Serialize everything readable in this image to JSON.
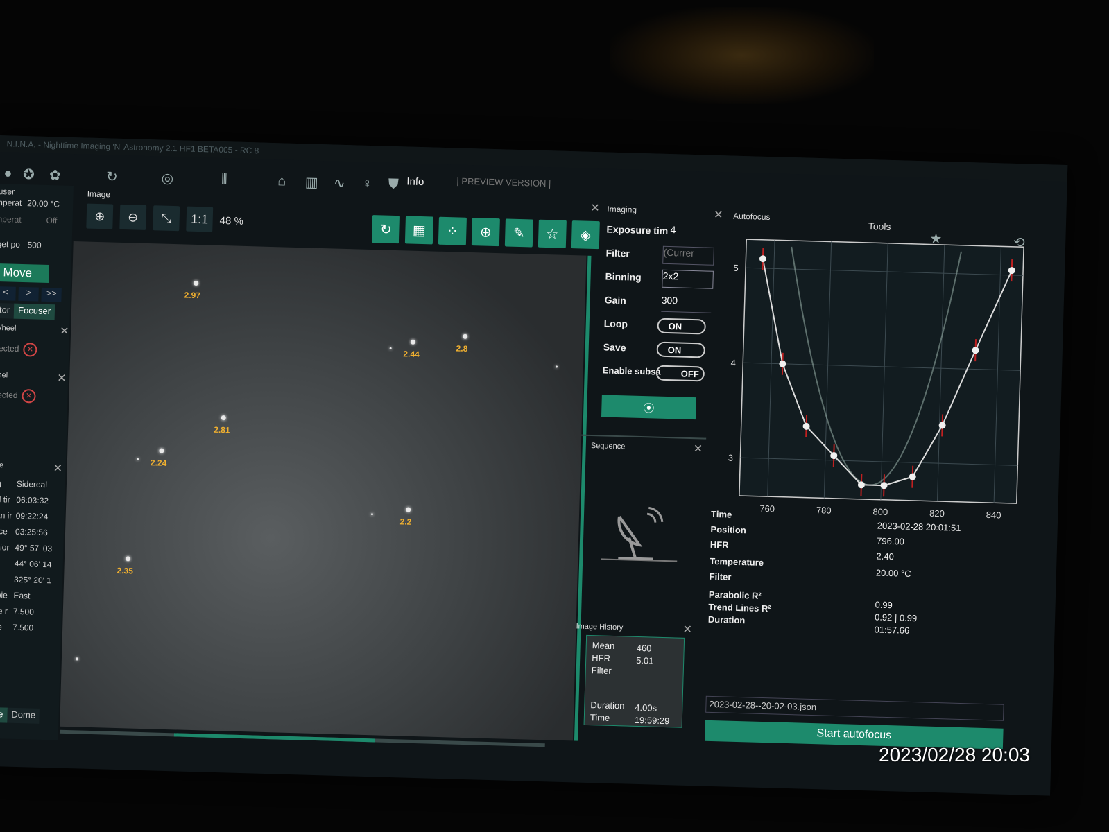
{
  "window": {
    "title": "N.I.N.A. - Nighttime Imaging 'N' Astronomy 2.1 HF1 BETA005 - RC 8",
    "preview_label": "| PREVIEW VERSION |"
  },
  "toolbar": {
    "info_label": "Info"
  },
  "left": {
    "focuser_header": "user",
    "temp_label": "nperat",
    "temp_value": "20.00 °C",
    "temp2_label": "nperat",
    "temp2_value": "Off",
    "target_label": "get po",
    "target_value": "500",
    "move_label": "Move",
    "nav": [
      "<",
      ">",
      ">>"
    ],
    "tabs": [
      "tor",
      "Focuser"
    ],
    "filterwheel_header": "Wheel",
    "filterwheel_status": "nected",
    "panel_header": "anel",
    "panel_status": "nected",
    "mount_header": "ope",
    "mount_rows": [
      {
        "k": "ing",
        "v": "Sidereal"
      },
      {
        "k": "eal tir",
        "v": "06:03:32"
      },
      {
        "k": "dian ir",
        "v": "09:22:24"
      },
      {
        "k": "Asce",
        "v": "03:25:56"
      },
      {
        "k": "natior",
        "v": "49° 57' 03"
      },
      {
        "k": "de",
        "v": "44° 06' 14"
      },
      {
        "k": "uth",
        "v": "325° 20' 1"
      },
      {
        "k": "of pie",
        "v": "East"
      },
      {
        "k": "uide r",
        "v": "7.500"
      },
      {
        "k": "uide",
        "v": "7.500"
      }
    ],
    "bottom_tabs": [
      "ope",
      "Dome"
    ]
  },
  "image": {
    "title": "Image",
    "zoom_buttons": [
      "zoom-in",
      "zoom-out",
      "fit",
      "1:1"
    ],
    "one_to_one": "1:1",
    "zoom_value": "48 %",
    "hfr_labels": [
      "2.97",
      "2.44",
      "2.8",
      "2.81",
      "2.24",
      "2.2",
      "2.35"
    ]
  },
  "imaging": {
    "header": "Imaging",
    "exposure_label": "Exposure tim",
    "exposure_value": "4",
    "filter_label": "Filter",
    "filter_value": "(Currer",
    "binning_label": "Binning",
    "binning_value": "2x2",
    "gain_label": "Gain",
    "gain_value": "300",
    "loop_label": "Loop",
    "loop_value": "ON",
    "save_label": "Save",
    "save_value": "ON",
    "subsample_label": "Enable subsa",
    "subsample_value": "OFF"
  },
  "sequence": {
    "header": "Sequence"
  },
  "history": {
    "header": "Image History",
    "mean_label": "Mean",
    "mean_value": "460",
    "hfr_label": "HFR",
    "hfr_value": "5.01",
    "filter_label": "Filter",
    "duration_label": "Duration",
    "duration_value": "4.00s",
    "time_label": "Time",
    "time_value": "19:59:29"
  },
  "autofocus": {
    "header": "Autofocus",
    "info": [
      {
        "k": "Time",
        "v": "2023-02-28 20:01:51"
      },
      {
        "k": "Position",
        "v": "796.00"
      },
      {
        "k": "HFR",
        "v": "2.40"
      },
      {
        "k": "Temperature",
        "v": "20.00 °C"
      },
      {
        "k": "Filter",
        "v": ""
      },
      {
        "k": "Parabolic R²",
        "v": "0.99"
      },
      {
        "k": "Trend Lines R²",
        "v": "0.92 | 0.99"
      },
      {
        "k": "Duration",
        "v": "01:57.66"
      }
    ],
    "file": "2023-02-28--20-02-03.json",
    "start_label": "Start autofocus"
  },
  "tools": {
    "label": "Tools"
  },
  "photo_timestamp": "2023/02/28 20:03",
  "chart_data": {
    "type": "scatter",
    "x": [
      756,
      764,
      773,
      783,
      793,
      801,
      811,
      821,
      832,
      844
    ],
    "y": [
      5.1,
      4.0,
      3.35,
      3.05,
      2.75,
      2.75,
      2.85,
      3.4,
      4.2,
      5.05
    ],
    "xticks": [
      "760",
      "780",
      "800",
      "820",
      "840"
    ],
    "yticks": [
      "3",
      "4",
      "5"
    ],
    "xlim": [
      750,
      848
    ],
    "ylim": [
      2.6,
      5.3
    ],
    "grid": true
  }
}
